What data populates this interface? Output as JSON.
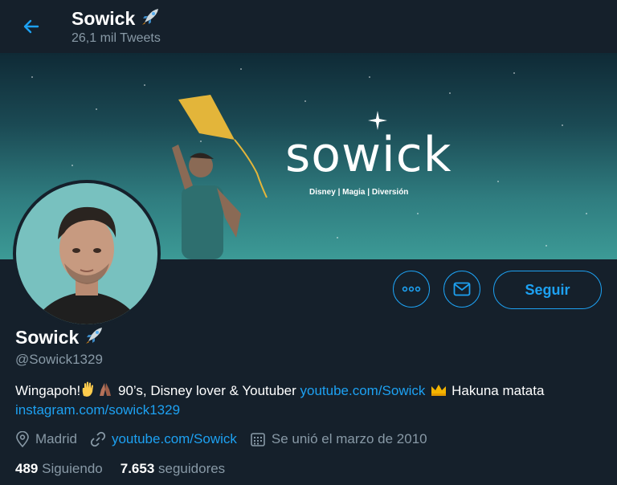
{
  "header": {
    "name": "Sowick",
    "tweets_count": "26,1 mil Tweets"
  },
  "banner": {
    "logo_text": "sowick",
    "tagline": "Disney | Magia | Diversión"
  },
  "actions": {
    "follow_label": "Seguir"
  },
  "profile": {
    "name": "Sowick",
    "handle": "@Sowick1329",
    "bio": {
      "part1": "Wingapoh!",
      "part2": " 90’s, Disney lover & Youtuber ",
      "link1": "youtube.com/Sowick",
      "part3": " Hakuna matata ",
      "link2": "instagram.com/sowick1329"
    },
    "location": "Madrid",
    "website": "youtube.com/Sowick",
    "joined": "Se unió el marzo de 2010",
    "following_count": "489",
    "following_label": "Siguiendo",
    "followers_count": "7.653",
    "followers_label": "seguidores"
  },
  "colors": {
    "background": "#15202b",
    "accent": "#1da1f2",
    "secondary_text": "#8899a6"
  },
  "icons": [
    "back-arrow-icon",
    "rocket-icon",
    "more-icon",
    "mail-icon",
    "location-icon",
    "link-icon",
    "calendar-icon",
    "hand-icon",
    "pray-icon",
    "crown-icon"
  ]
}
